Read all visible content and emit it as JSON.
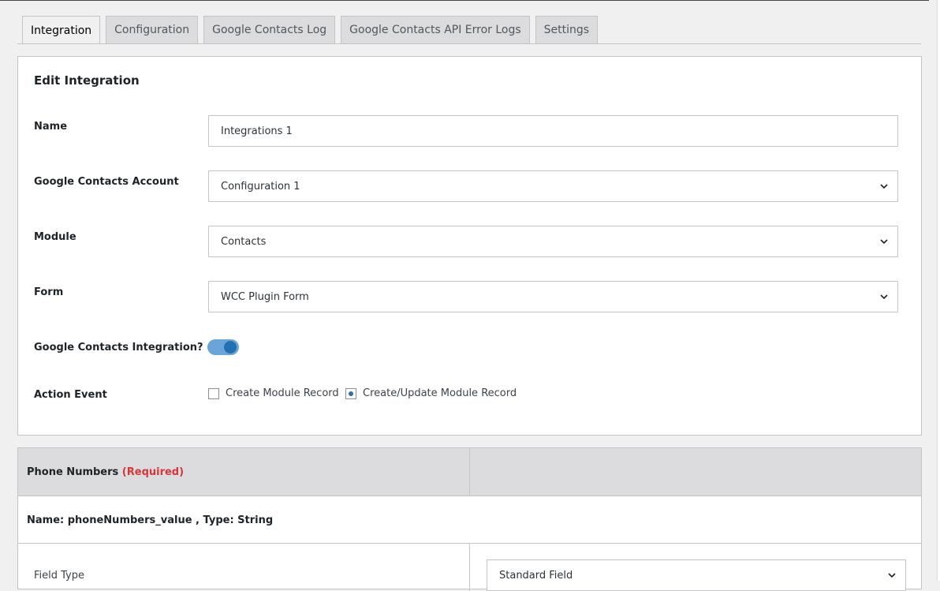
{
  "tabs": [
    {
      "label": "Integration",
      "active": true
    },
    {
      "label": "Configuration",
      "active": false
    },
    {
      "label": "Google Contacts Log",
      "active": false
    },
    {
      "label": "Google Contacts API Error Logs",
      "active": false
    },
    {
      "label": "Settings",
      "active": false
    }
  ],
  "panel": {
    "title": "Edit Integration",
    "name": {
      "label": "Name",
      "value": "Integrations 1"
    },
    "account": {
      "label": "Google Contacts Account",
      "value": "Configuration 1"
    },
    "module": {
      "label": "Module",
      "value": "Contacts"
    },
    "form": {
      "label": "Form",
      "value": "WCC Plugin Form"
    },
    "integration_toggle": {
      "label": "Google Contacts Integration?",
      "enabled": true
    },
    "action_event": {
      "label": "Action Event",
      "options": [
        {
          "label": "Create Module Record",
          "checked": false
        },
        {
          "label": "Create/Update Module Record",
          "checked": true
        }
      ]
    }
  },
  "mapping": {
    "header_title": "Phone Numbers",
    "header_required": "(Required)",
    "meta": "Name: phoneNumbers_value , Type: String",
    "field_type_label": "Field Type",
    "field_type_value": "Standard Field"
  },
  "colors": {
    "accent": "#2271b1",
    "toggle_track": "#6aa4d8",
    "required": "#d63638"
  }
}
